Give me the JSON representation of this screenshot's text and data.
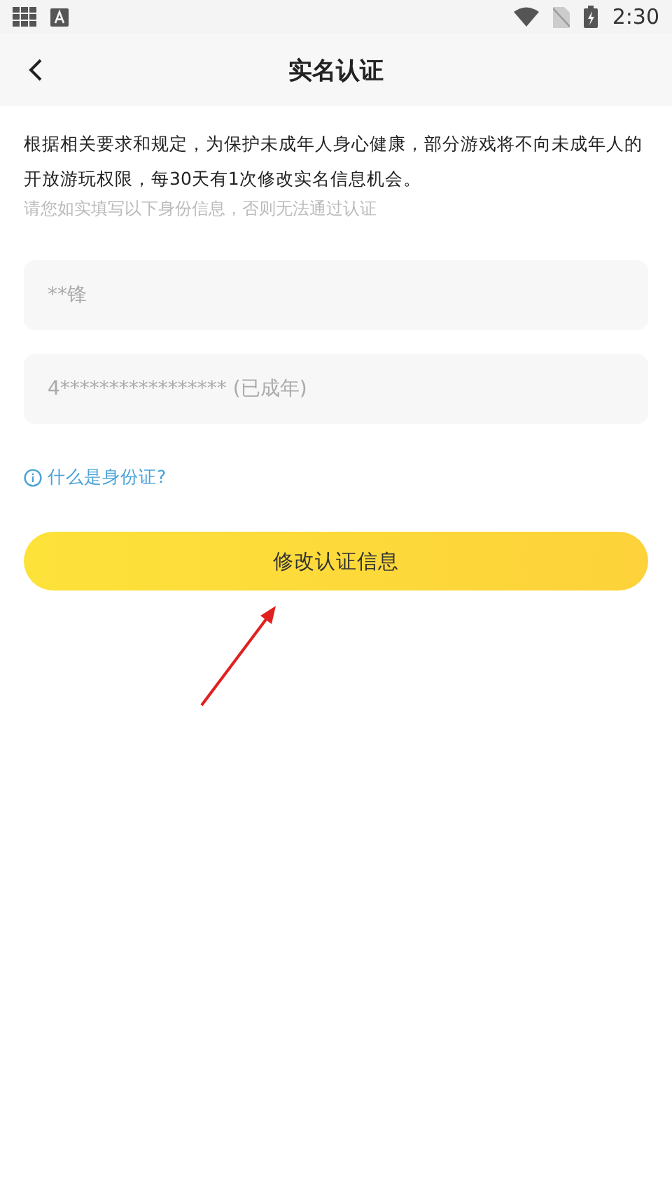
{
  "status_bar": {
    "time": "2:30"
  },
  "header": {
    "title": "实名认证"
  },
  "notice": "根据相关要求和规定，为保护未成年人身心健康，部分游戏将不向未成年人的开放游玩权限，每30天有1次修改实名信息机会。",
  "hint": "请您如实填写以下身份信息，否则无法通过认证",
  "fields": [
    {
      "value": "**锋",
      "disabled": true
    },
    {
      "value": "4***************** (已成年)",
      "disabled": true
    }
  ],
  "help_link": "什么是身份证?",
  "submit_button": "修改认证信息"
}
